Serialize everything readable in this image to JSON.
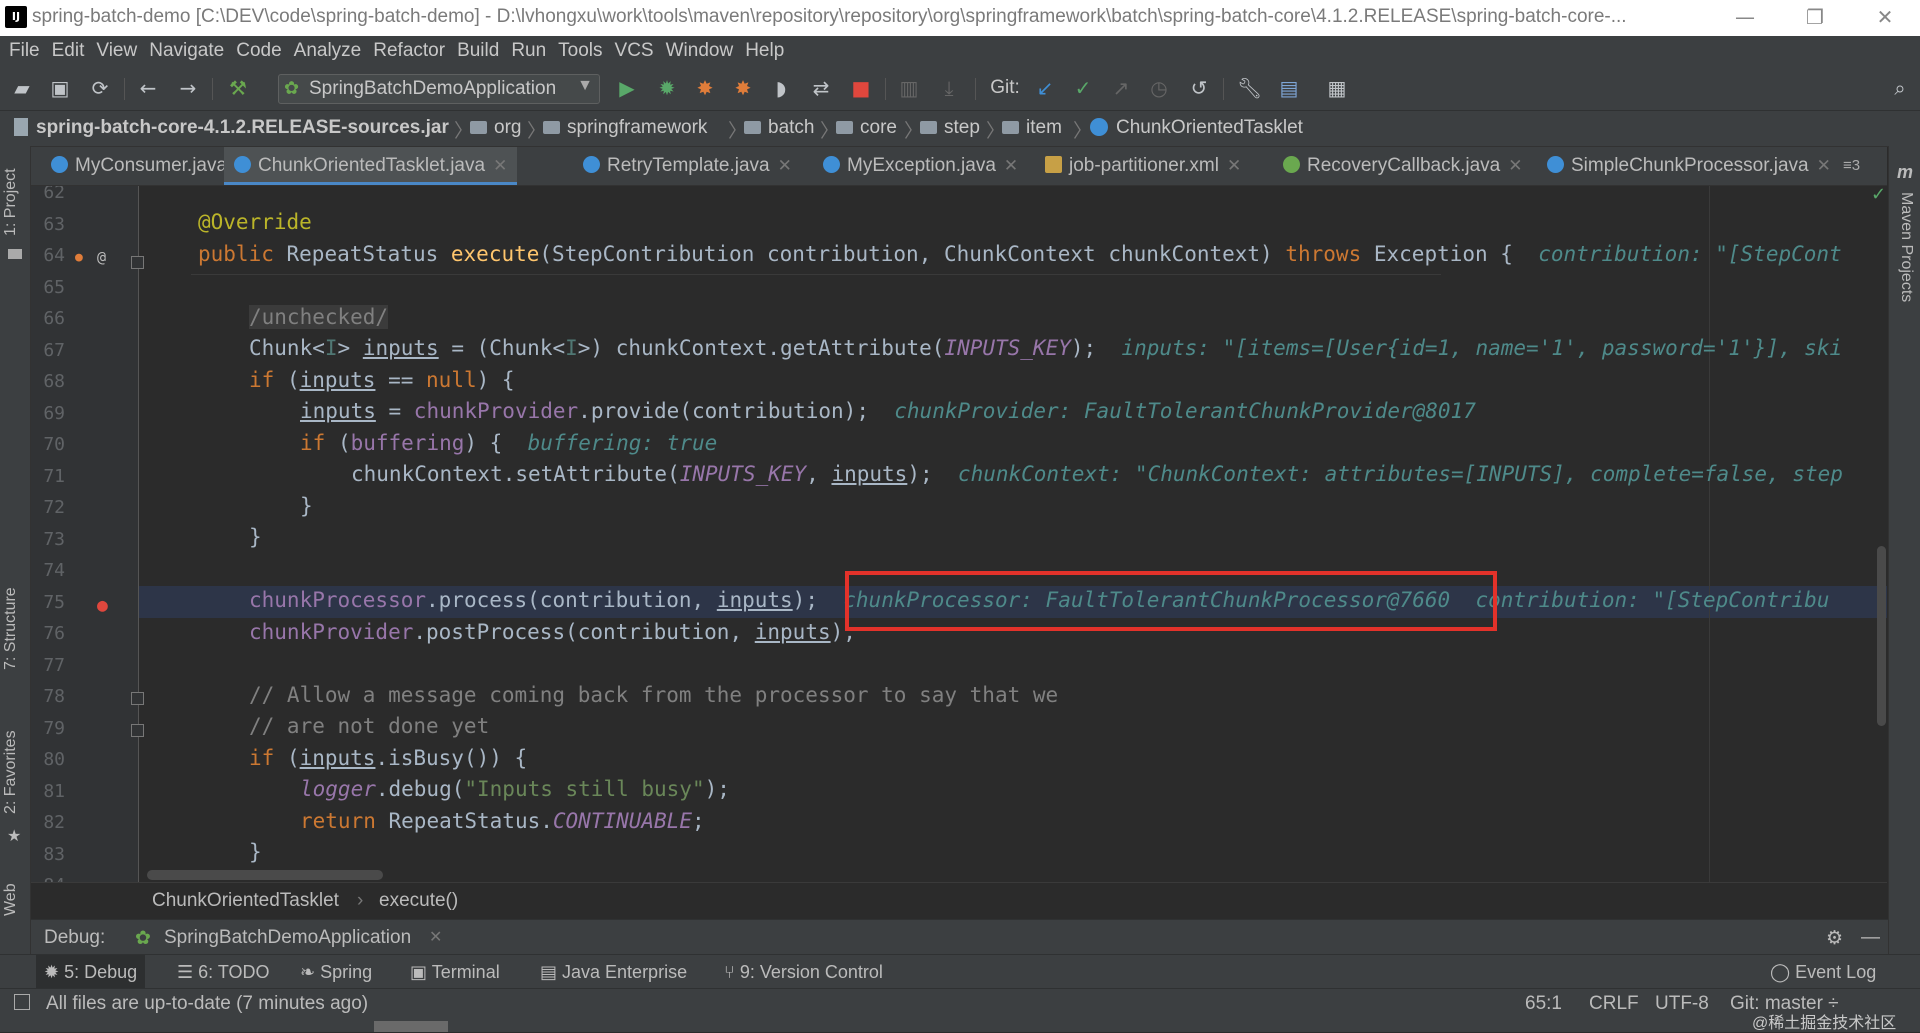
{
  "window": {
    "title": "spring-batch-demo [C:\\DEV\\code\\spring-batch-demo] - D:\\lvhongxu\\work\\tools\\maven\\repository\\repository\\org\\springframework\\batch\\spring-batch-core\\4.1.2.RELEASE\\spring-batch-core-...",
    "app_icon": "IJ",
    "controls": [
      "—",
      "❐",
      "✕"
    ]
  },
  "menu": [
    "File",
    "Edit",
    "View",
    "Navigate",
    "Code",
    "Analyze",
    "Refactor",
    "Build",
    "Run",
    "Tools",
    "VCS",
    "Window",
    "Help"
  ],
  "toolbar": {
    "run_config": "SpringBatchDemoApplication",
    "git_label": "Git:"
  },
  "navbar": {
    "items": [
      "spring-batch-core-4.1.2.RELEASE-sources.jar",
      "org",
      "springframework",
      "batch",
      "core",
      "step",
      "item",
      "ChunkOrientedTasklet"
    ]
  },
  "left_tools": [
    "1: Project",
    "7: Structure",
    "2: Favorites",
    "Web"
  ],
  "right_tools": [
    "Maven Projects"
  ],
  "tabs": [
    {
      "label": "MyConsumer.java",
      "color": "#3f8fd6"
    },
    {
      "label": "ChunkOrientedTasklet.java",
      "color": "#3f8fd6",
      "active": true
    },
    {
      "label": "RetryTemplate.java",
      "color": "#3f8fd6"
    },
    {
      "label": "MyException.java",
      "color": "#3f8fd6"
    },
    {
      "label": "job-partitioner.xml",
      "color": "#c7a046"
    },
    {
      "label": "RecoveryCallback.java",
      "color": "#6aa84f"
    },
    {
      "label": "SimpleChunkProcessor.java",
      "color": "#3f8fd6"
    }
  ],
  "tabs_overflow": "≡3",
  "editor": {
    "line_numbers": [
      "62",
      "63",
      "64",
      "65",
      "66",
      "67",
      "68",
      "69",
      "70",
      "71",
      "72",
      "73",
      "74",
      "75",
      "76",
      "77",
      "78",
      "79",
      "80",
      "81",
      "82",
      "83",
      "84"
    ],
    "lines": {
      "l63": "@Override",
      "l64_a": "public ",
      "l64_b": "RepeatStatus ",
      "l64_c": "execute",
      "l64_d": "(StepContribution contribution, ChunkContext chunkContext) ",
      "l64_e": "throws ",
      "l64_f": "Exception {",
      "l64_hint": "contribution: \"[StepCont",
      "l66": "/unchecked/",
      "l67_a": "Chunk<",
      "l67_b": "I",
      "l67_c": "> ",
      "l67_d": "inputs",
      "l67_e": " = (Chunk<",
      "l67_f": "I",
      "l67_g": ">) chunkContext.getAttribute(",
      "l67_h": "INPUTS_KEY",
      "l67_i": ");",
      "l67_hint": "inputs: \"[items=[User{id=1, name='1', password='1'}], ski",
      "l68_a": "if ",
      "l68_b": "(",
      "l68_c": "inputs",
      "l68_d": " == ",
      "l68_e": "null",
      "l68_f": ") {",
      "l69_a": "inputs",
      "l69_b": " = ",
      "l69_c": "chunkProvider",
      "l69_d": ".provide(contribution);",
      "l69_hint": "chunkProvider: FaultTolerantChunkProvider@8017",
      "l70_a": "if ",
      "l70_b": "(",
      "l70_c": "buffering",
      "l70_d": ") {",
      "l70_hint": "buffering: true",
      "l71_a": "chunkContext.setAttribute(",
      "l71_b": "INPUTS_KEY",
      "l71_c": ", ",
      "l71_d": "inputs",
      "l71_e": ");",
      "l71_hint": "chunkContext: \"ChunkContext: attributes=[INPUTS], complete=false, step",
      "l72": "}",
      "l73": "}",
      "l75_a": "chunkProcessor",
      "l75_b": ".process(contribution, ",
      "l75_c": "inputs",
      "l75_d": ");",
      "l75_hint": "chunkProcessor: FaultTolerantChunkProcessor@7660",
      "l75_hint2": "contribution: \"[StepContribu",
      "l76_a": "chunkProvider",
      "l76_b": ".postProcess(contribution, ",
      "l76_c": "inputs",
      "l76_d": ");",
      "l78": "// Allow a message coming back from the processor to say that we",
      "l79": "// are not done yet",
      "l80_a": "if ",
      "l80_b": "(",
      "l80_c": "inputs",
      "l80_d": ".isBusy()) {",
      "l81_a": "logger",
      "l81_b": ".debug(",
      "l81_c": "\"Inputs still busy\"",
      "l81_d": ");",
      "l82_a": "return ",
      "l82_b": "RepeatStatus.",
      "l82_c": "CONTINUABLE",
      "l82_d": ";",
      "l83": "}"
    }
  },
  "editor_breadcrumb": [
    "ChunkOrientedTasklet",
    "execute()"
  ],
  "debug": {
    "label": "Debug:",
    "session": "SpringBatchDemoApplication"
  },
  "tool_windows": [
    {
      "label": "5: Debug",
      "active": true
    },
    {
      "label": "6: TODO"
    },
    {
      "label": "Spring"
    },
    {
      "label": "Terminal"
    },
    {
      "label": "Java Enterprise"
    },
    {
      "label": "9: Version Control"
    }
  ],
  "event_log": "Event Log",
  "status": {
    "message": "All files are up-to-date (7 minutes ago)",
    "position": "65:1",
    "line_sep": "CRLF",
    "encoding": "UTF-8",
    "git_branch": "Git: master ÷",
    "watermark": "@稀土掘金技术社区"
  }
}
